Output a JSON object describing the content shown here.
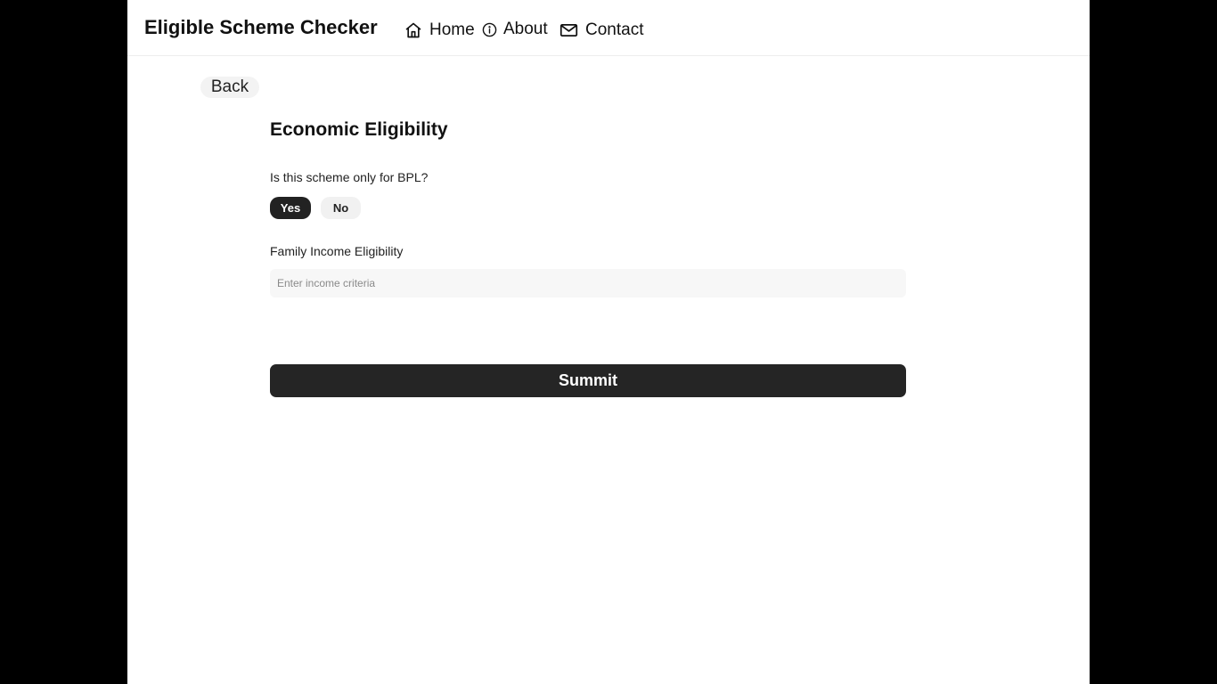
{
  "header": {
    "title": "Eligible Scheme Checker",
    "nav": {
      "home": {
        "label": "Home",
        "icon": "home-icon"
      },
      "about": {
        "label": "About",
        "icon": "info-icon"
      },
      "contact": {
        "label": "Contact",
        "icon": "mail-icon"
      }
    }
  },
  "main": {
    "back_label": "Back",
    "section_title": "Economic Eligibility",
    "bpl_question": {
      "label": "Is this scheme only for BPL?",
      "options": [
        "Yes",
        "No"
      ],
      "selected": "Yes"
    },
    "income": {
      "label": "Family Income Eligibility",
      "value": "",
      "placeholder": "Enter income criteria"
    },
    "submit_label": "Summit"
  },
  "colors": {
    "backdrop": "#000000",
    "page_background": "#ffffff",
    "primary_dark": "#252525",
    "chip_light": "#f1f1f1",
    "input_background": "#f7f7f7",
    "text": "#111111"
  }
}
